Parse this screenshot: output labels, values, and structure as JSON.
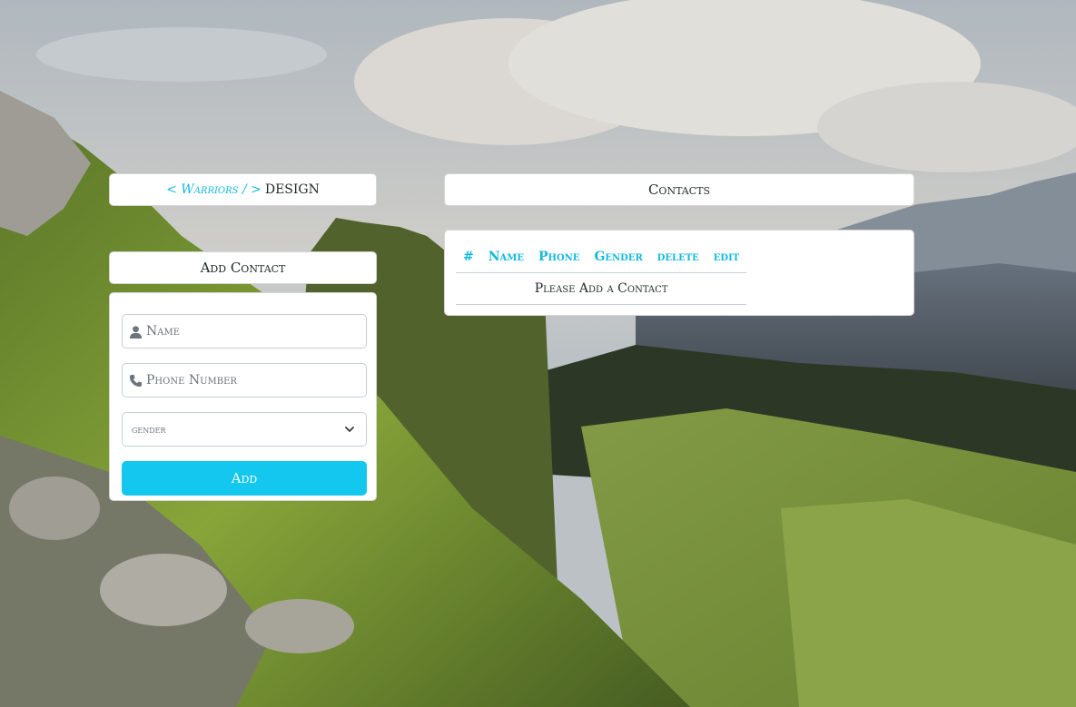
{
  "brand": {
    "accent": "< Warriors / >",
    "rest": "DESIGN"
  },
  "contacts_panel": {
    "title": "Contacts",
    "columns": [
      "#",
      "Name",
      "Phone",
      "Gender",
      "delete",
      "edit"
    ],
    "empty_message": "Please Add a Contact"
  },
  "add_contact": {
    "title": "Add Contact",
    "name_placeholder": "Name",
    "phone_placeholder": "Phone Number",
    "gender_selected": "gender",
    "add_label": "Add"
  },
  "icons": {
    "name": "user-icon",
    "phone": "phone-icon",
    "select": "chevron-down-icon"
  },
  "colors": {
    "accent": "#13b8df",
    "button": "#13c7ef"
  }
}
